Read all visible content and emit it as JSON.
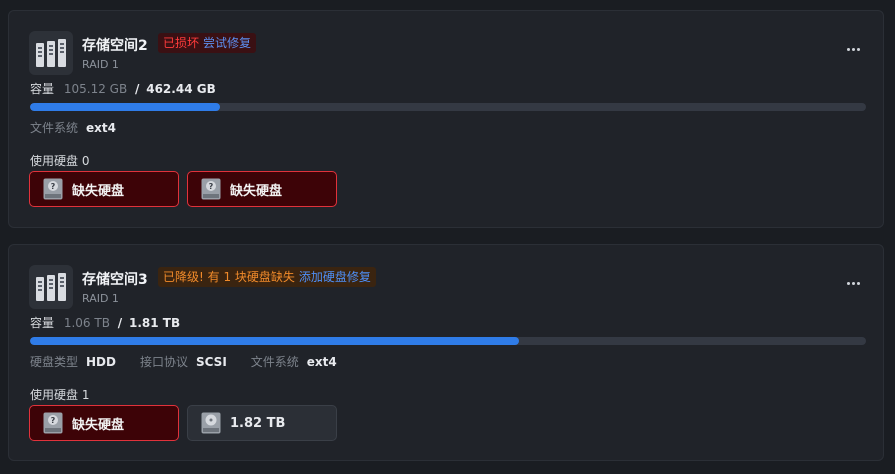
{
  "pools": [
    {
      "name": "存储空间2",
      "raid": "RAID 1",
      "status": {
        "error_text": "已损坏",
        "action_text": "尝试修复",
        "color": "#ff3b3b"
      },
      "capacity": {
        "label": "容量",
        "used": "105.12 GB",
        "separator": "/",
        "total": "462.44 GB",
        "used_fraction": 0.227
      },
      "meta": [
        {
          "key": "文件系统",
          "value": "ext4"
        }
      ],
      "disks_label": "使用硬盘 0",
      "disks": [
        {
          "label": "缺失硬盘",
          "state": "missing",
          "icon": "missing-disk-icon"
        },
        {
          "label": "缺失硬盘",
          "state": "missing",
          "icon": "missing-disk-icon"
        }
      ]
    },
    {
      "name": "存储空间3",
      "raid": "RAID 1",
      "status": {
        "warn_text": "已降级! 有 1 块硬盘缺失",
        "action_text": "添加硬盘修复",
        "color": "#f08a2a"
      },
      "capacity": {
        "label": "容量",
        "used": "1.06 TB",
        "separator": "/",
        "total": "1.81 TB",
        "used_fraction": 0.585
      },
      "meta": [
        {
          "key": "硬盘类型",
          "value": "HDD"
        },
        {
          "key": "接口协议",
          "value": "SCSI"
        },
        {
          "key": "文件系统",
          "value": "ext4"
        }
      ],
      "disks_label": "使用硬盘 1",
      "disks": [
        {
          "label": "缺失硬盘",
          "state": "missing",
          "icon": "missing-disk-icon"
        },
        {
          "label": "1.82 TB",
          "state": "ok",
          "icon": "hdd-icon"
        }
      ]
    }
  ],
  "colors": {
    "accent": "#2f7ce8",
    "danger": "#e1323b",
    "warning": "#f08a2a",
    "link": "#4e8ff7"
  },
  "icons": {
    "pool": "storage-pool-icon",
    "more": "more-horizontal-icon"
  }
}
